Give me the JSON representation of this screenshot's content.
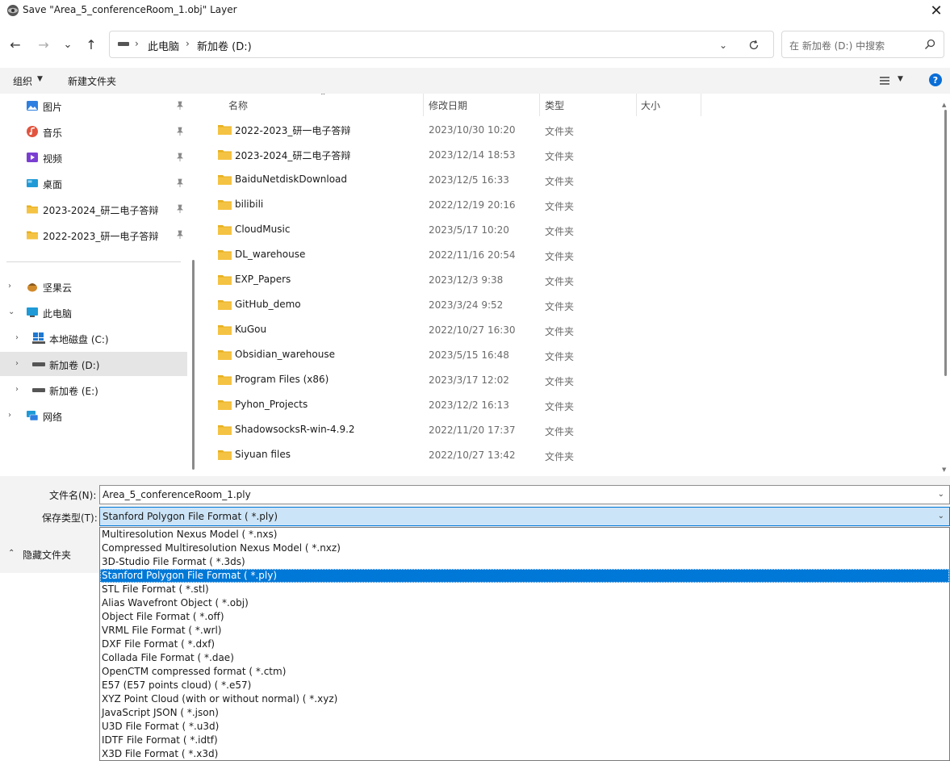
{
  "window": {
    "title": "Save \"Area_5_conferenceRoom_1.obj\" Layer",
    "close_glyph": "✕"
  },
  "nav": {
    "back_glyph": "←",
    "forward_glyph": "→",
    "recent_glyph": "⌄",
    "up_glyph": "↑"
  },
  "address": {
    "separator": "›",
    "crumbs": [
      "此电脑",
      "新加卷 (D:)"
    ]
  },
  "search": {
    "placeholder": "在 新加卷 (D:) 中搜索"
  },
  "toolbar": {
    "organize": "组织",
    "new_folder": "新建文件夹",
    "help": "?"
  },
  "sidebar": {
    "quick_access": [
      {
        "label": "图片",
        "icon": "pictures-icon",
        "color": "#2f7fe0"
      },
      {
        "label": "音乐",
        "icon": "music-icon",
        "color": "#e2543e"
      },
      {
        "label": "视频",
        "icon": "videos-icon",
        "color": "#7a3fd1"
      },
      {
        "label": "桌面",
        "icon": "desktop-icon",
        "color": "#1f9ad6"
      },
      {
        "label": "2023-2024_研二电子答辩",
        "icon": "folder-icon",
        "color": "#f5c343"
      },
      {
        "label": "2022-2023_研一电子答辩",
        "icon": "folder-icon",
        "color": "#f5c343"
      }
    ],
    "tree": [
      {
        "label": "坚果云",
        "icon": "jianguoyun-icon",
        "expanded": false
      },
      {
        "label": "此电脑",
        "icon": "this-pc-icon",
        "expanded": true
      },
      {
        "label": "本地磁盘 (C:)",
        "icon": "windows-drive-icon",
        "expanded": false
      },
      {
        "label": "新加卷 (D:)",
        "icon": "drive-icon",
        "expanded": false,
        "selected": true
      },
      {
        "label": "新加卷 (E:)",
        "icon": "drive-icon",
        "expanded": false
      },
      {
        "label": "网络",
        "icon": "network-icon",
        "expanded": false
      }
    ]
  },
  "columns": {
    "name": "名称",
    "date": "修改日期",
    "type": "类型",
    "size": "大小",
    "sort_glyph": "⌃"
  },
  "files": [
    {
      "name": "2022-2023_研一电子答辩",
      "date": "2023/10/30 10:20",
      "type": "文件夹"
    },
    {
      "name": "2023-2024_研二电子答辩",
      "date": "2023/12/14 18:53",
      "type": "文件夹"
    },
    {
      "name": "BaiduNetdiskDownload",
      "date": "2023/12/5 16:33",
      "type": "文件夹"
    },
    {
      "name": "bilibili",
      "date": "2022/12/19 20:16",
      "type": "文件夹"
    },
    {
      "name": "CloudMusic",
      "date": "2023/5/17 10:20",
      "type": "文件夹"
    },
    {
      "name": "DL_warehouse",
      "date": "2022/11/16 20:54",
      "type": "文件夹"
    },
    {
      "name": "EXP_Papers",
      "date": "2023/12/3 9:38",
      "type": "文件夹"
    },
    {
      "name": "GitHub_demo",
      "date": "2023/3/24 9:52",
      "type": "文件夹"
    },
    {
      "name": "KuGou",
      "date": "2022/10/27 16:30",
      "type": "文件夹"
    },
    {
      "name": "Obsidian_warehouse",
      "date": "2023/5/15 16:48",
      "type": "文件夹"
    },
    {
      "name": "Program Files (x86)",
      "date": "2023/3/17 12:02",
      "type": "文件夹"
    },
    {
      "name": "Pyhon_Projects",
      "date": "2023/12/2 16:13",
      "type": "文件夹"
    },
    {
      "name": "ShadowsocksR-win-4.9.2",
      "date": "2022/11/20 17:37",
      "type": "文件夹"
    },
    {
      "name": "Siyuan files",
      "date": "2022/10/27 13:42",
      "type": "文件夹"
    }
  ],
  "form": {
    "filename_label": "文件名(N):",
    "filename_value": "Area_5_conferenceRoom_1.ply",
    "savetype_label": "保存类型(T):",
    "savetype_value": "Stanford Polygon File Format ( *.ply)",
    "hide_folders": "隐藏文件夹",
    "chevron": "⌄"
  },
  "dropdown": {
    "selected_index": 3,
    "options": [
      "Multiresolution Nexus Model ( *.nxs)",
      "Compressed Multiresolution Nexus Model ( *.nxz)",
      "3D-Studio File Format ( *.3ds)",
      "Stanford Polygon File Format ( *.ply)",
      "STL File Format ( *.stl)",
      "Alias Wavefront Object ( *.obj)",
      "Object File Format ( *.off)",
      "VRML File Format ( *.wrl)",
      "DXF File Format ( *.dxf)",
      "Collada File Format ( *.dae)",
      "OpenCTM compressed format ( *.ctm)",
      "E57 (E57 points cloud) ( *.e57)",
      "XYZ Point Cloud (with or without normal) ( *.xyz)",
      "JavaScript JSON ( *.json)",
      "U3D File Format ( *.u3d)",
      "IDTF File Format ( *.idtf)",
      "X3D File Format ( *.x3d)"
    ]
  },
  "colors": {
    "accent": "#0078d7",
    "folder": "#f5c343",
    "selection_bg": "#cce4f7"
  }
}
